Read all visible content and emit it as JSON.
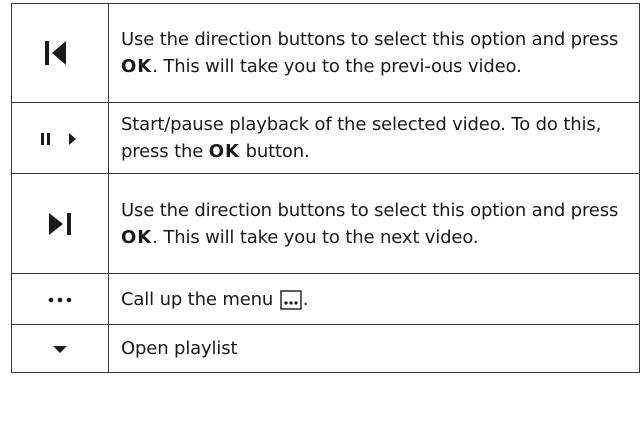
{
  "rows": [
    {
      "icon": "skip-previous-icon",
      "text_a": "Use the direction buttons to select this option and press ",
      "keyword": "OK",
      "text_b": ". This will take you to the previ-ous video."
    },
    {
      "icon": "play-pause-icon",
      "text_a": "Start/pause playback of the selected video. To do this, press the ",
      "keyword": "OK",
      "text_b": " button."
    },
    {
      "icon": "skip-next-icon",
      "text_a": "Use the direction buttons to select this option and press ",
      "keyword": "OK",
      "text_b": ". This will take you to the next video."
    },
    {
      "icon": "ellipsis-icon",
      "text_a": "Call up the menu ",
      "inline_icon": "menu-icon",
      "text_b": "."
    },
    {
      "icon": "dropdown-arrow-icon",
      "text_a": "Open playlist"
    }
  ]
}
